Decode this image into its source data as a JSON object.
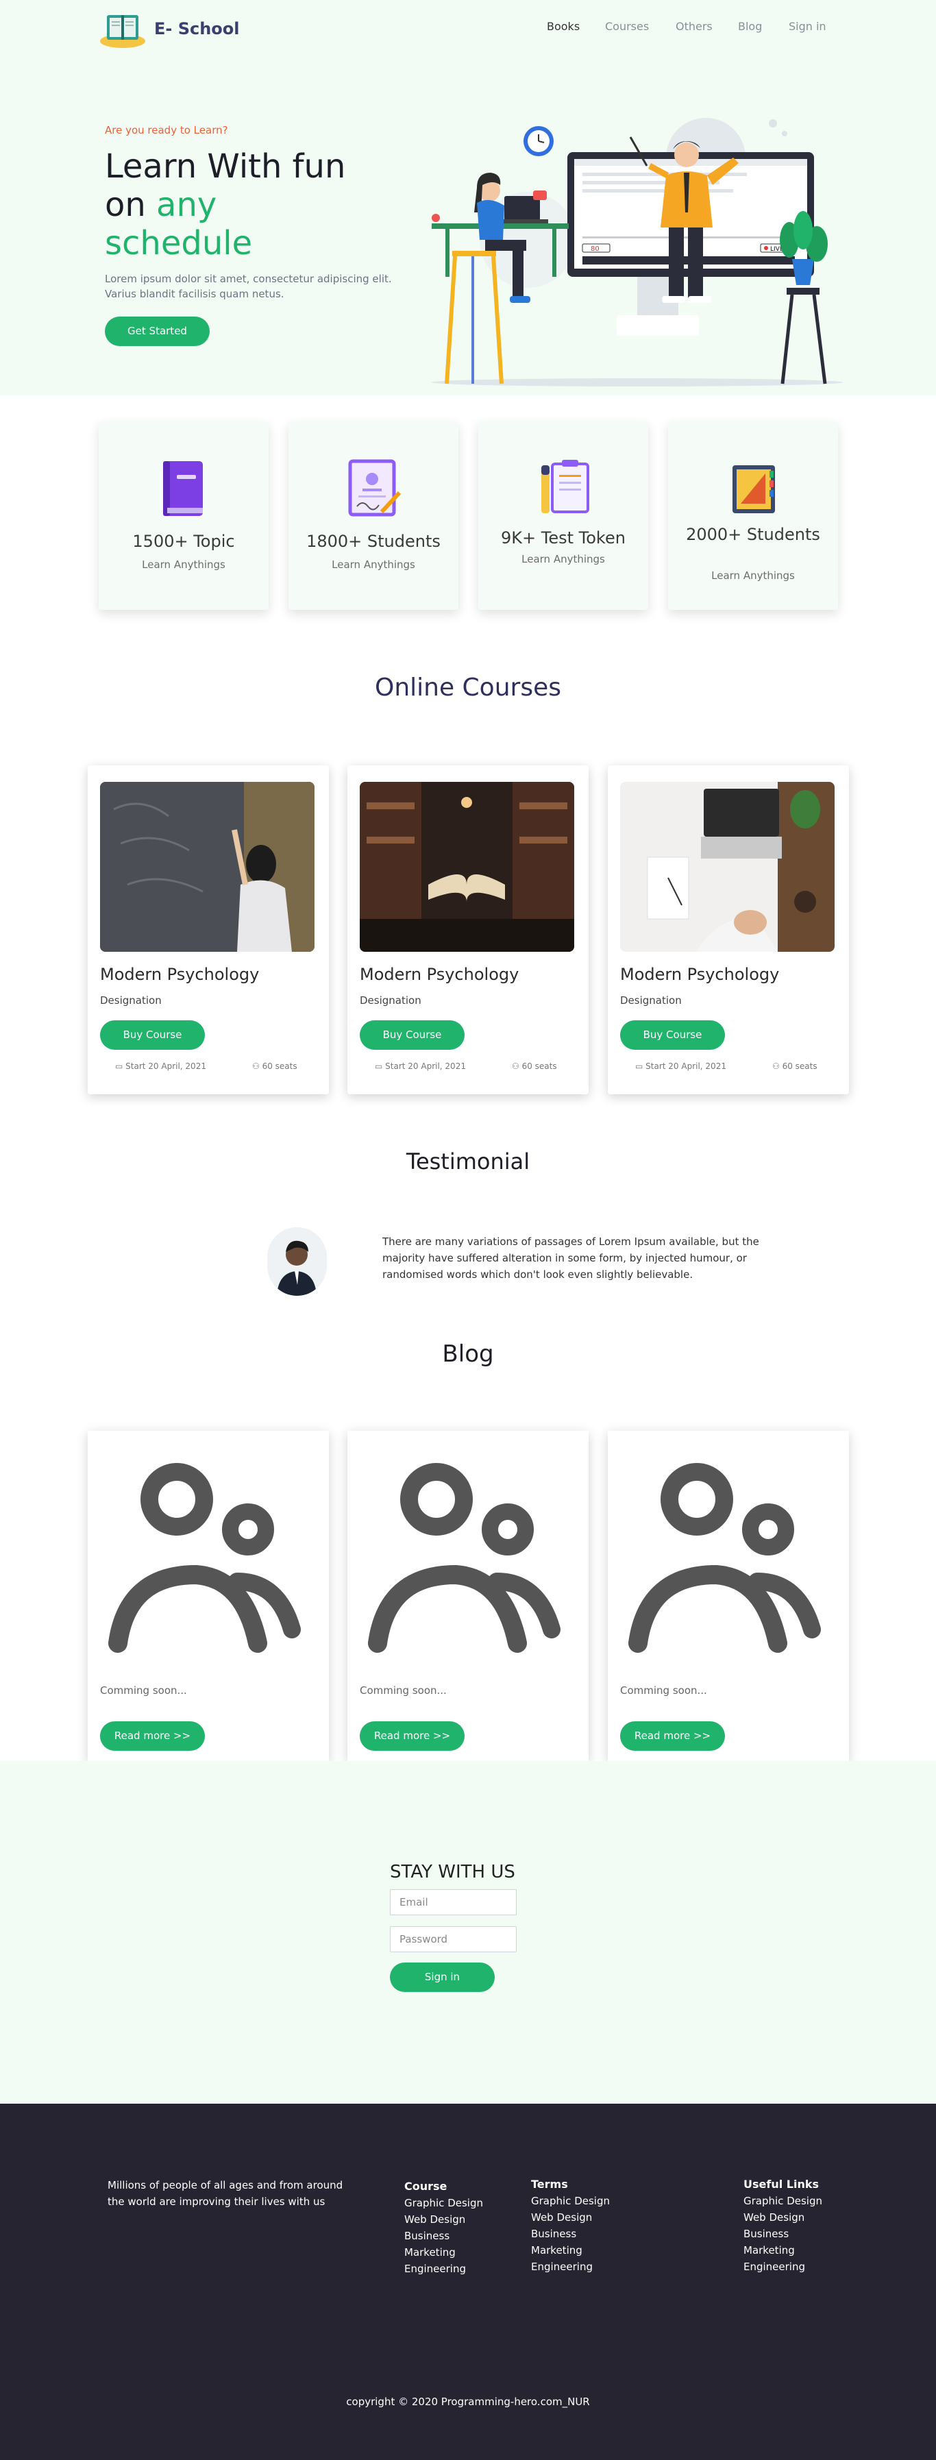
{
  "brand": {
    "name": "E- School"
  },
  "nav": [
    "Books",
    "Courses",
    "Others",
    "Blog",
    "Sign in"
  ],
  "hero": {
    "eyebrow": "Are you ready to Learn?",
    "title_line1": "Learn With fun",
    "title_line2a": "on ",
    "title_line2b": "any",
    "title_line3": "schedule",
    "description": "Lorem ipsum dolor sit amet, consectetur adipiscing elit. Varius blandit facilisis quam netus.",
    "cta": "Get Started",
    "screen_count": "80",
    "screen_live": "LIVE"
  },
  "stats": [
    {
      "title": "1500+ Topic",
      "subtitle": "Learn Anythings",
      "icon": "book-icon"
    },
    {
      "title": "1800+ Students",
      "subtitle": "Learn Anythings",
      "icon": "certificate-icon"
    },
    {
      "title": "9K+ Test Token",
      "subtitle": "Learn Anythings",
      "icon": "clipboard-pencil-icon"
    },
    {
      "title": "2000+ Students",
      "subtitle": "Learn Anythings",
      "icon": "books-ruler-icon"
    }
  ],
  "courses_section": {
    "title": "Online Courses"
  },
  "courses": [
    {
      "title": "Modern Psychology",
      "designation": "Designation",
      "button": "Buy Course",
      "date": "Start 20 April, 2021",
      "seats": "60 seats"
    },
    {
      "title": "Modern Psychology",
      "designation": "Designation",
      "button": "Buy Course",
      "date": "Start 20 April, 2021",
      "seats": "60 seats"
    },
    {
      "title": "Modern Psychology",
      "designation": "Designation",
      "button": "Buy Course",
      "date": "Start 20 April, 2021",
      "seats": "60 seats"
    }
  ],
  "testimonial": {
    "title": "Testimonial",
    "text": "There are many variations of passages of Lorem Ipsum available, but the majority have suffered alteration in some form, by injected humour, or randomised words which don't look even slightly believable."
  },
  "blog_section": {
    "title": "Blog"
  },
  "blogs": [
    {
      "text": "Comming soon...",
      "button": "Read more >>"
    },
    {
      "text": "Comming soon...",
      "button": "Read more >>"
    },
    {
      "text": "Comming soon...",
      "button": "Read more >>"
    }
  ],
  "subscribe": {
    "title": "STAY WITH US",
    "email_placeholder": "Email",
    "password_placeholder": "Password",
    "button": "Sign in"
  },
  "footer": {
    "about": "Millions of people of all ages and from around the world are improving their lives with us",
    "columns": [
      {
        "heading": "Course",
        "items": [
          "Graphic Design",
          "Web Design",
          "Business",
          "Marketing",
          "Engineering"
        ]
      },
      {
        "heading": "Terms",
        "items": [
          "Graphic Design",
          "Web Design",
          "Business",
          "Marketing",
          "Engineering"
        ]
      },
      {
        "heading": "Useful Links",
        "items": [
          "Graphic Design",
          "Web Design",
          "Business",
          "Marketing",
          "Engineering"
        ]
      }
    ],
    "copyright": "copyright © 2020 Programming-hero.com_NUR"
  },
  "colors": {
    "accent": "#20b36b",
    "eyebrow": "#ef5f36",
    "hero_bg": "#f2fcf4",
    "footer_bg": "#262430",
    "heading": "#2e2f5c"
  }
}
